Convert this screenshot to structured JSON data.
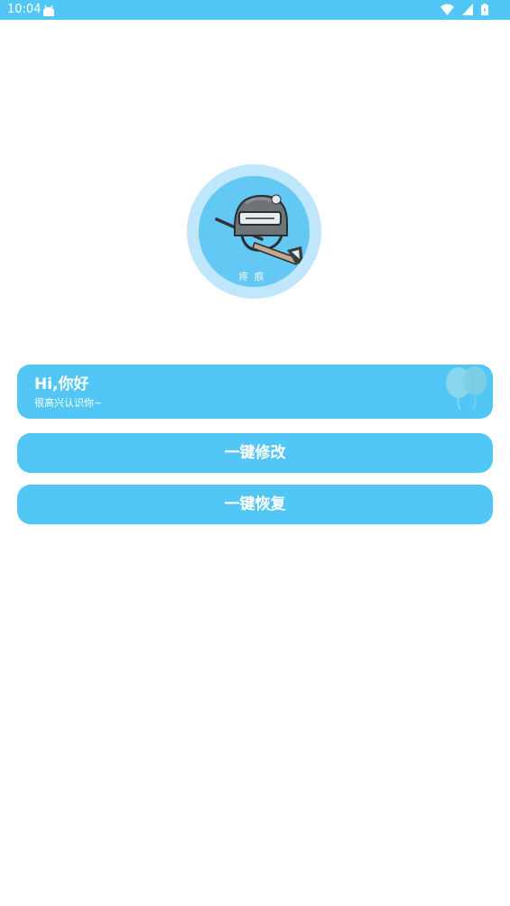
{
  "status_bar": {
    "time": "10:04",
    "background": "#52c6f4",
    "icons": [
      "android-notification-icon",
      "wifi-icon",
      "signal-icon",
      "battery-icon"
    ]
  },
  "avatar": {
    "caption": "疼痕",
    "ring_color": "#bfe6fb",
    "fill_color": "#63c8f4"
  },
  "greeting": {
    "title": "Hi,你好",
    "subtitle": "很高兴认识你~"
  },
  "buttons": {
    "modify_label": "一键修改",
    "restore_label": "一键恢复"
  },
  "colors": {
    "accent": "#52c6f4",
    "background": "#ffffff"
  }
}
